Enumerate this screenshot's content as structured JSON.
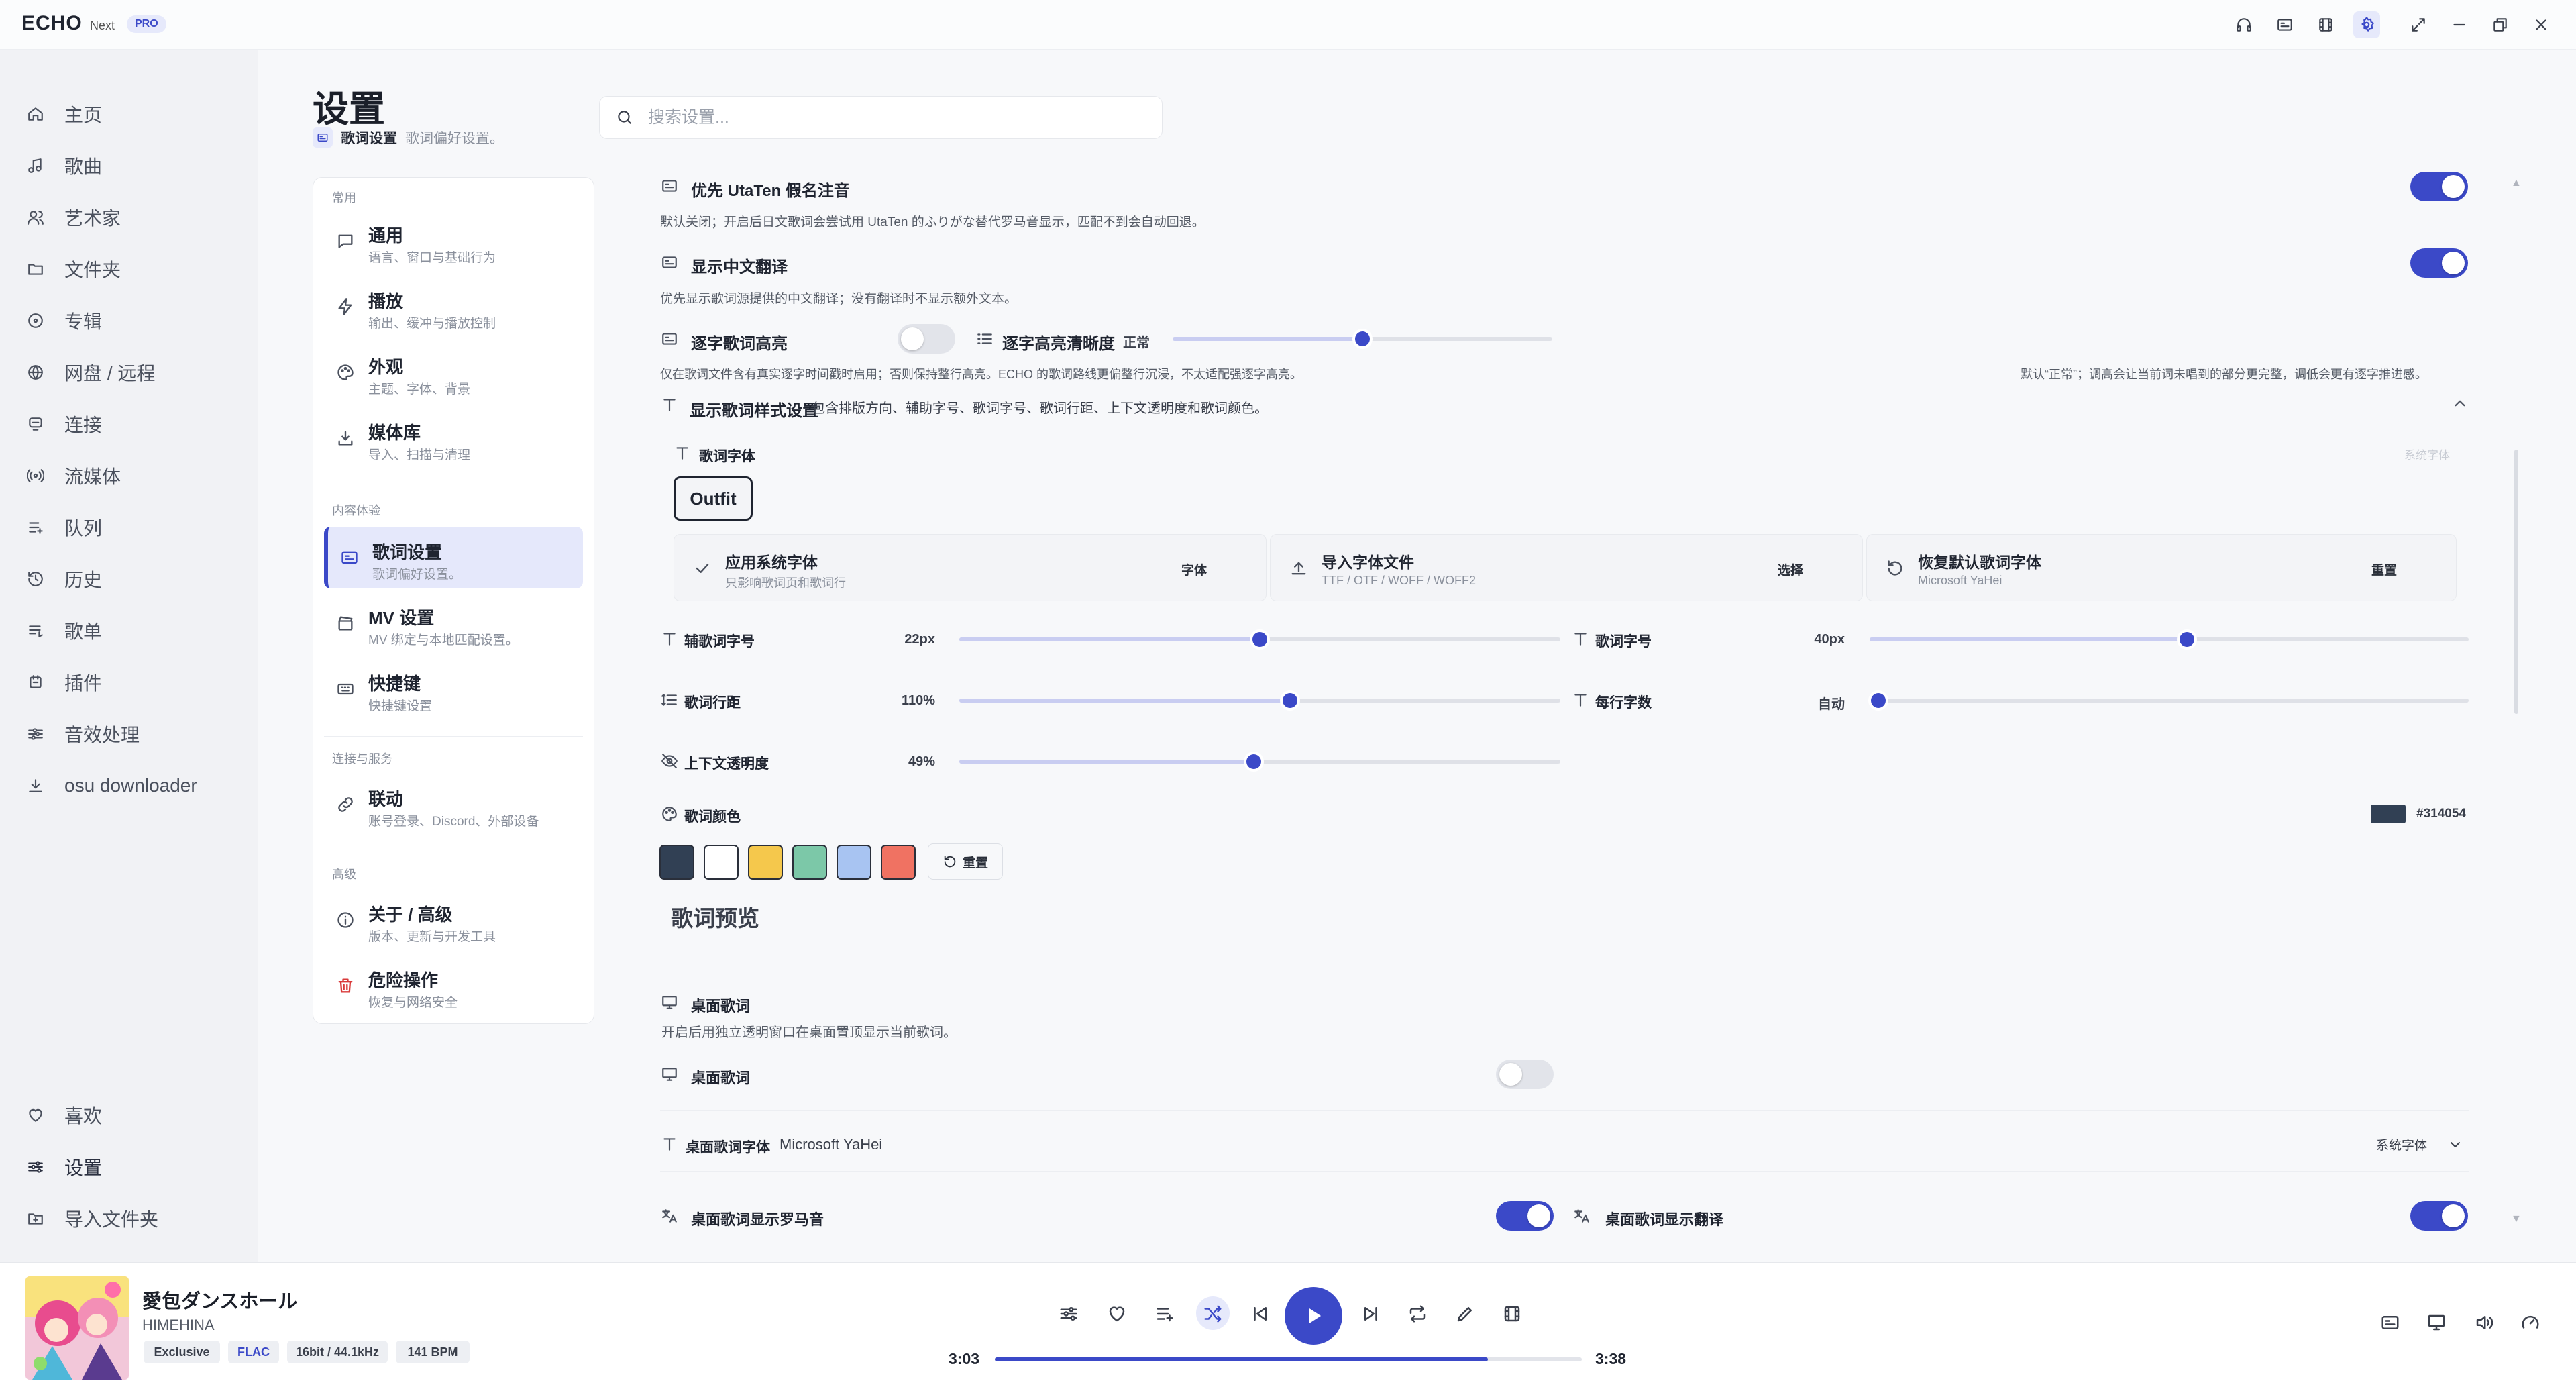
{
  "app": {
    "logo": "ECHO",
    "edition": "Next",
    "badge": "PRO"
  },
  "titlebar": {
    "buttons": [
      "headphones-icon",
      "lyrics-icon",
      "film-icon",
      "settings-icon",
      "expand-icon",
      "minimize-icon",
      "restore-icon",
      "close-icon"
    ]
  },
  "sidebar": {
    "items": [
      {
        "label": "主页",
        "icon": "home-icon"
      },
      {
        "label": "歌曲",
        "icon": "music-note-icon"
      },
      {
        "label": "艺术家",
        "icon": "users-icon"
      },
      {
        "label": "文件夹",
        "icon": "folder-icon"
      },
      {
        "label": "专辑",
        "icon": "disc-icon"
      },
      {
        "label": "网盘 / 远程",
        "icon": "globe-icon"
      },
      {
        "label": "连接",
        "icon": "connect-icon"
      },
      {
        "label": "流媒体",
        "icon": "stream-icon"
      },
      {
        "label": "队列",
        "icon": "queue-icon"
      },
      {
        "label": "历史",
        "icon": "history-icon"
      },
      {
        "label": "歌单",
        "icon": "playlist-icon"
      },
      {
        "label": "插件",
        "icon": "plugin-icon"
      },
      {
        "label": "音效处理",
        "icon": "equalizer-icon"
      },
      {
        "label": "osu downloader",
        "icon": "download-icon"
      }
    ],
    "bottom": [
      {
        "label": "喜欢",
        "icon": "heart-icon"
      },
      {
        "label": "设置",
        "icon": "sliders-icon"
      },
      {
        "label": "导入文件夹",
        "icon": "folder-import-icon"
      }
    ]
  },
  "page": {
    "title": "设置",
    "crumb_section": "歌词设置",
    "crumb_desc": "歌词偏好设置。"
  },
  "search": {
    "placeholder": "搜索设置..."
  },
  "settings_nav": {
    "groups": {
      "common": "常用",
      "content": "内容体验",
      "connect": "连接与服务",
      "advanced": "高级"
    },
    "items": [
      {
        "title": "通用",
        "subtitle": "语言、窗口与基础行为"
      },
      {
        "title": "播放",
        "subtitle": "输出、缓冲与播放控制"
      },
      {
        "title": "外观",
        "subtitle": "主题、字体、背景"
      },
      {
        "title": "媒体库",
        "subtitle": "导入、扫描与清理"
      },
      {
        "title": "歌词设置",
        "subtitle": "歌词偏好设置。"
      },
      {
        "title": "MV 设置",
        "subtitle": "MV 绑定与本地匹配设置。"
      },
      {
        "title": "快捷键",
        "subtitle": "快捷键设置"
      },
      {
        "title": "联动",
        "subtitle": "账号登录、Discord、外部设备"
      },
      {
        "title": "关于 / 高级",
        "subtitle": "版本、更新与开发工具"
      },
      {
        "title": "危险操作",
        "subtitle": "恢复与网络安全"
      }
    ]
  },
  "content": {
    "utaten": {
      "label": "优先 UtaTen 假名注音",
      "desc": "默认关闭；开启后日文歌词会尝试用 UtaTen 的ふりがな替代罗马音显示，匹配不到会自动回退。",
      "on": true
    },
    "translation": {
      "label": "显示中文翻译",
      "desc": "优先显示歌词源提供的中文翻译；没有翻译时不显示额外文本。",
      "on": true
    },
    "word_highlight": {
      "label": "逐字歌词高亮",
      "on": false,
      "desc": "仅在歌词文件含有真实逐字时间戳时启用；否则保持整行高亮。ECHO 的歌词路线更偏整行沉浸，不太适配强逐字高亮。"
    },
    "highlight_clarity": {
      "label": "逐字高亮清晰度",
      "value_text": "正常",
      "value": 0.5,
      "desc": "默认“正常”；调高会让当前词未唱到的部分更完整，调低会更有逐字推进感。"
    },
    "style": {
      "label": "显示歌词样式设置",
      "desc": "包含排版方向、辅助字号、歌词字号、歌词行距、上下文透明度和歌词颜色。"
    },
    "font": {
      "label": "歌词字体",
      "current": "Outfit",
      "hint": "系统字体"
    },
    "font_cards": [
      {
        "title": "应用系统字体",
        "subtitle": "只影响歌词页和歌词行",
        "button": "字体",
        "icon": "check-icon"
      },
      {
        "title": "导入字体文件",
        "subtitle": "TTF / OTF / WOFF / WOFF2",
        "button": "选择",
        "icon": "upload-icon"
      },
      {
        "title": "恢复默认歌词字体",
        "subtitle": "Microsoft YaHei",
        "button": "重置",
        "icon": "reset-icon"
      }
    ],
    "sliders": {
      "aux_size": {
        "label": "辅歌词字号",
        "value_text": "22px",
        "value": 0.5
      },
      "lyric_size": {
        "label": "歌词字号",
        "value_text": "40px",
        "value": 0.53
      },
      "line_spacing": {
        "label": "歌词行距",
        "value_text": "110%",
        "value": 0.55
      },
      "chars_per_line": {
        "label": "每行字数",
        "value_text": "自动",
        "value": 0.0
      },
      "context_opacity": {
        "label": "上下文透明度",
        "value_text": "49%",
        "value": 0.49
      }
    },
    "color": {
      "label": "歌词颜色",
      "hex": "#314054",
      "swatches": [
        "#314054",
        "#ffffff",
        "#f5c84c",
        "#7cc8a8",
        "#a8c4f2",
        "#f07262"
      ],
      "reset": "重置"
    },
    "preview": {
      "label": "歌词预览"
    },
    "desktop": {
      "title": "桌面歌词",
      "desc": "开启后用独立透明窗口在桌面置顶显示当前歌词。",
      "toggle_label": "桌面歌词",
      "toggle_on": false,
      "font_label": "桌面歌词字体",
      "font_value": "Microsoft YaHei",
      "font_select": "系统字体",
      "romaji_label": "桌面歌词显示罗马音",
      "romaji_on": true,
      "trans_label": "桌面歌词显示翻译",
      "trans_on": true
    }
  },
  "player": {
    "title": "愛包ダンスホール",
    "artist": "HIMEHINA",
    "badges": [
      "Exclusive",
      "FLAC",
      "16bit / 44.1kHz",
      "141 BPM"
    ],
    "elapsed": "3:03",
    "total": "3:38",
    "progress": 0.84
  },
  "colors": {
    "accent": "#3b49c8",
    "accent_soft": "#e6e9fb",
    "danger": "#d93a3a"
  }
}
